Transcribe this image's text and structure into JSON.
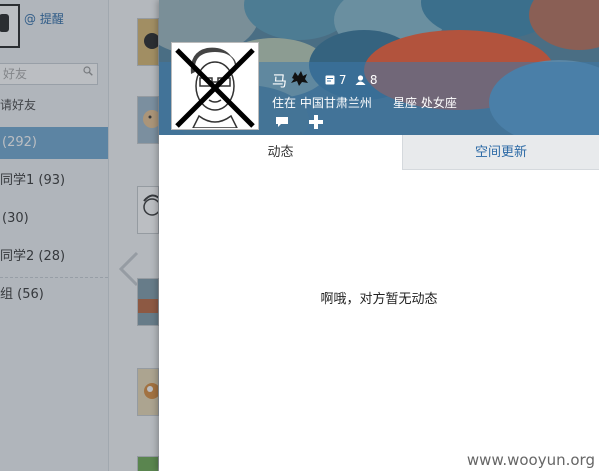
{
  "left_panel": {
    "remind_label": "@ 提醒",
    "search_placeholder": "好友",
    "invite_label": "请好友",
    "groups": [
      {
        "label": "(292)"
      },
      {
        "label": "同学1 (93)"
      },
      {
        "label": "(30)"
      },
      {
        "label": "同学2 (28)"
      },
      {
        "label": "组 (56)"
      }
    ]
  },
  "profile": {
    "name": "马",
    "post_count": "7",
    "follow_count": "8",
    "location": "住在 中国甘肃兰州",
    "zodiac": "星座 处女座"
  },
  "tabs": {
    "feed": "动态",
    "space_updates": "空间更新"
  },
  "empty_state": "啊哦，对方暂无动态",
  "watermark": "www.wooyun.org",
  "colors": {
    "accent": "#2c6aa6",
    "selected_group": "#6da6d0",
    "cover_band": "#3c78aa"
  },
  "icons": {
    "search": "search-icon",
    "message": "message-icon",
    "add": "add-icon",
    "posts": "posts-icon",
    "follows": "person-icon",
    "prev": "chevron-left-icon"
  }
}
